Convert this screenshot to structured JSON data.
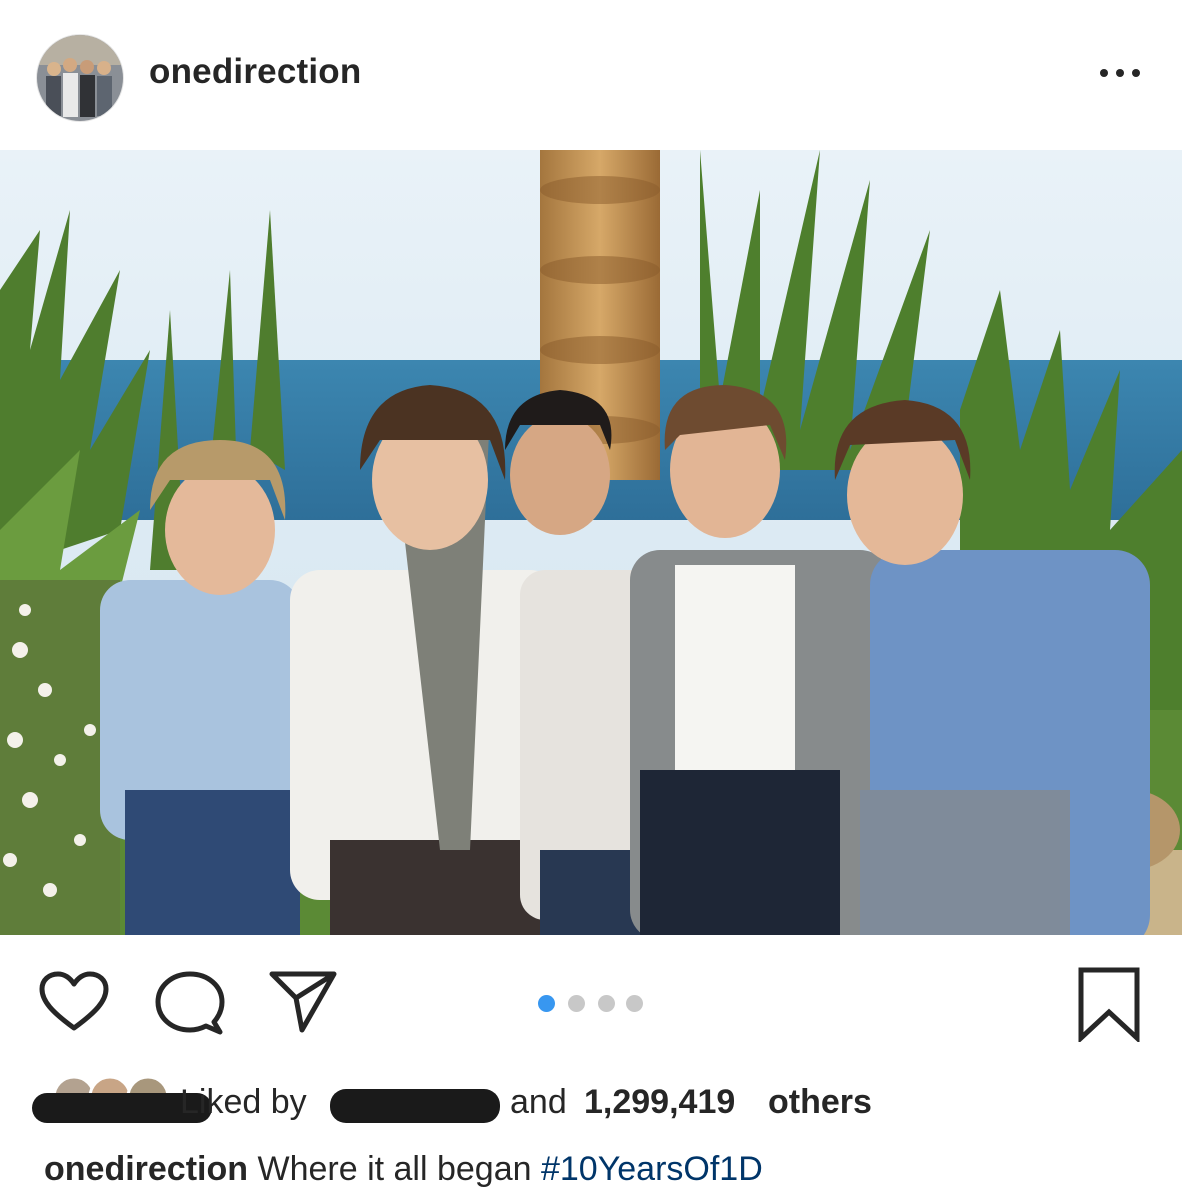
{
  "post": {
    "username": "onedirection",
    "more_label": "•••",
    "carousel": {
      "count": 4,
      "active_index": 0
    },
    "likes": {
      "liked_by_label": "Liked by",
      "and_label": "and",
      "count": "1,299,419",
      "others_label": "others"
    },
    "caption": {
      "username": "onedirection",
      "text": "Where it all began",
      "hashtag": "#10YearsOf1D"
    }
  },
  "colors": {
    "accent_blue": "#3897f0",
    "hashtag": "#003569",
    "inactive_dot": "#c8c8c8",
    "text": "#262626"
  },
  "icons": {
    "like": "heart-icon",
    "comment": "comment-bubble-icon",
    "share": "paper-plane-icon",
    "save": "bookmark-icon",
    "more": "ellipsis-icon"
  }
}
